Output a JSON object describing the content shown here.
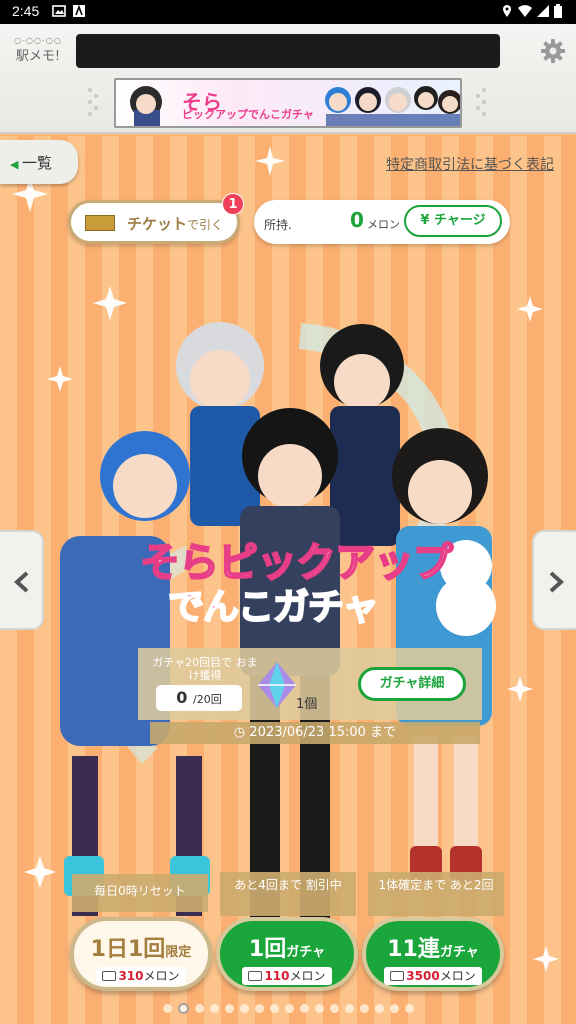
{
  "status_bar": {
    "time": "2:45"
  },
  "header": {
    "logo_text": "駅メモ!",
    "logo_dots": "○-○○-○○"
  },
  "banner": {
    "line1": "そら",
    "line2": "ピックアップでんこガチャ"
  },
  "nav": {
    "back_label": "一覧",
    "legal_link": "特定商取引法に基づく表記"
  },
  "ticket": {
    "label": "チケット",
    "suffix": "で引く",
    "badge": "1"
  },
  "wallet": {
    "label": "所持.",
    "amount": "0",
    "unit": "メロン",
    "charge_label": "¥ チャージ"
  },
  "gacha_title": {
    "line1": "そらピックアップ",
    "line2": "でんこガチャ"
  },
  "bonus": {
    "title": "ガチャ20回目で おまけ獲得",
    "count": "0",
    "of": "/20回",
    "item_count": "1個"
  },
  "detail_button": "ガチャ詳細",
  "deadline": "◷ 2023/06/23 15:00 まで",
  "buttons": [
    {
      "tag": "毎日0時リセット",
      "main": "1日1回",
      "suffix": "限定",
      "price": "310",
      "unit": "メロン"
    },
    {
      "tag": "あと4回まで 割引中",
      "main": "1回",
      "suffix": "ガチャ",
      "price": "110",
      "unit": "メロン"
    },
    {
      "tag": "1体確定まで あと2回",
      "main": "11連",
      "suffix": "ガチャ",
      "price": "3500",
      "unit": "メロン"
    }
  ],
  "pager": {
    "count": 17,
    "active": 1
  },
  "colors": {
    "green": "#1aa43a",
    "orange_stripe": "#fbb072",
    "pink": "#ef3d8c",
    "gold": "#c9a974"
  }
}
